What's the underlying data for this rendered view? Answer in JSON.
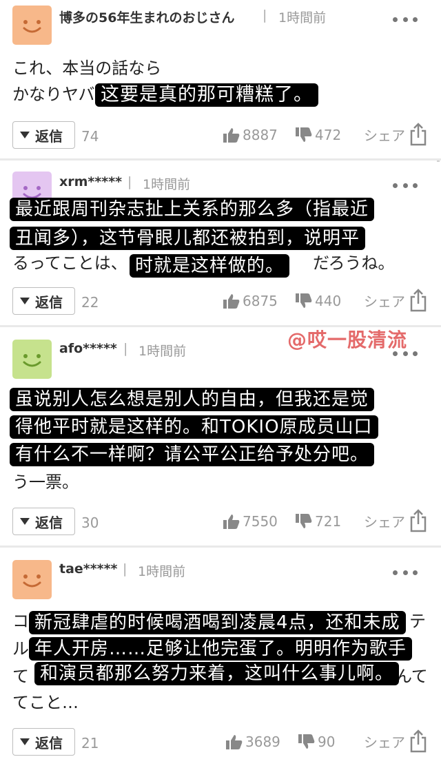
{
  "watermark": "@哎一股清流",
  "comments": [
    {
      "username": "博多の56年生まれのおじさん",
      "time": "1時間前",
      "avatar_color": "#f7b88a",
      "avatar_face": "#c56a35",
      "lines": [
        "これ、本当の話なら",
        "かなりヤバ"
      ],
      "overlay": [
        "这要是真的那可糟糕了。"
      ],
      "reply_label": "返信",
      "reply_count": "74",
      "likes": "8887",
      "dislikes": "472",
      "share_label": "シェア"
    },
    {
      "username": "xrm*****",
      "time": "1時間前",
      "avatar_color": "#e4c6f1",
      "avatar_face": "#a468c5",
      "lines": [
        "るってことは、",
        "だろうね。"
      ],
      "overlay": [
        "最近跟周刊杂志扯上关系的那么多（指最近",
        "丑闻多），这节骨眼儿都还被拍到，说明平",
        "时就是这样做的。"
      ],
      "reply_label": "返信",
      "reply_count": "22",
      "likes": "6875",
      "dislikes": "440",
      "share_label": "シェア"
    },
    {
      "username": "afo*****",
      "time": "1時間前",
      "avatar_color": "#c6e28d",
      "avatar_face": "#6a9a2c",
      "lines": [
        "う一票。"
      ],
      "overlay": [
        "虽说别人怎么想是别人的自由，但我还是觉",
        "得他平时就是这样的。和TOKIO原成员山口",
        "有什么不一样啊？请公平公正给予处分吧。"
      ],
      "reply_label": "返信",
      "reply_count": "30",
      "likes": "7550",
      "dislikes": "721",
      "share_label": "シェア"
    },
    {
      "username": "tae*****",
      "time": "1時間前",
      "avatar_color": "#f7b88a",
      "avatar_face": "#c56a35",
      "lines": [
        "コ",
        "テ",
        "ル",
        "て",
        "んて",
        "てこと…"
      ],
      "overlay": [
        "新冠肆虐的时候喝酒喝到凌晨4点，还和未成",
        "年人开房……足够让他完蛋了。明明作为歌手",
        "和演员都那么努力来着，这叫什么事儿啊。"
      ],
      "reply_label": "返信",
      "reply_count": "21",
      "likes": "3689",
      "dislikes": "90",
      "share_label": "シェア"
    }
  ]
}
